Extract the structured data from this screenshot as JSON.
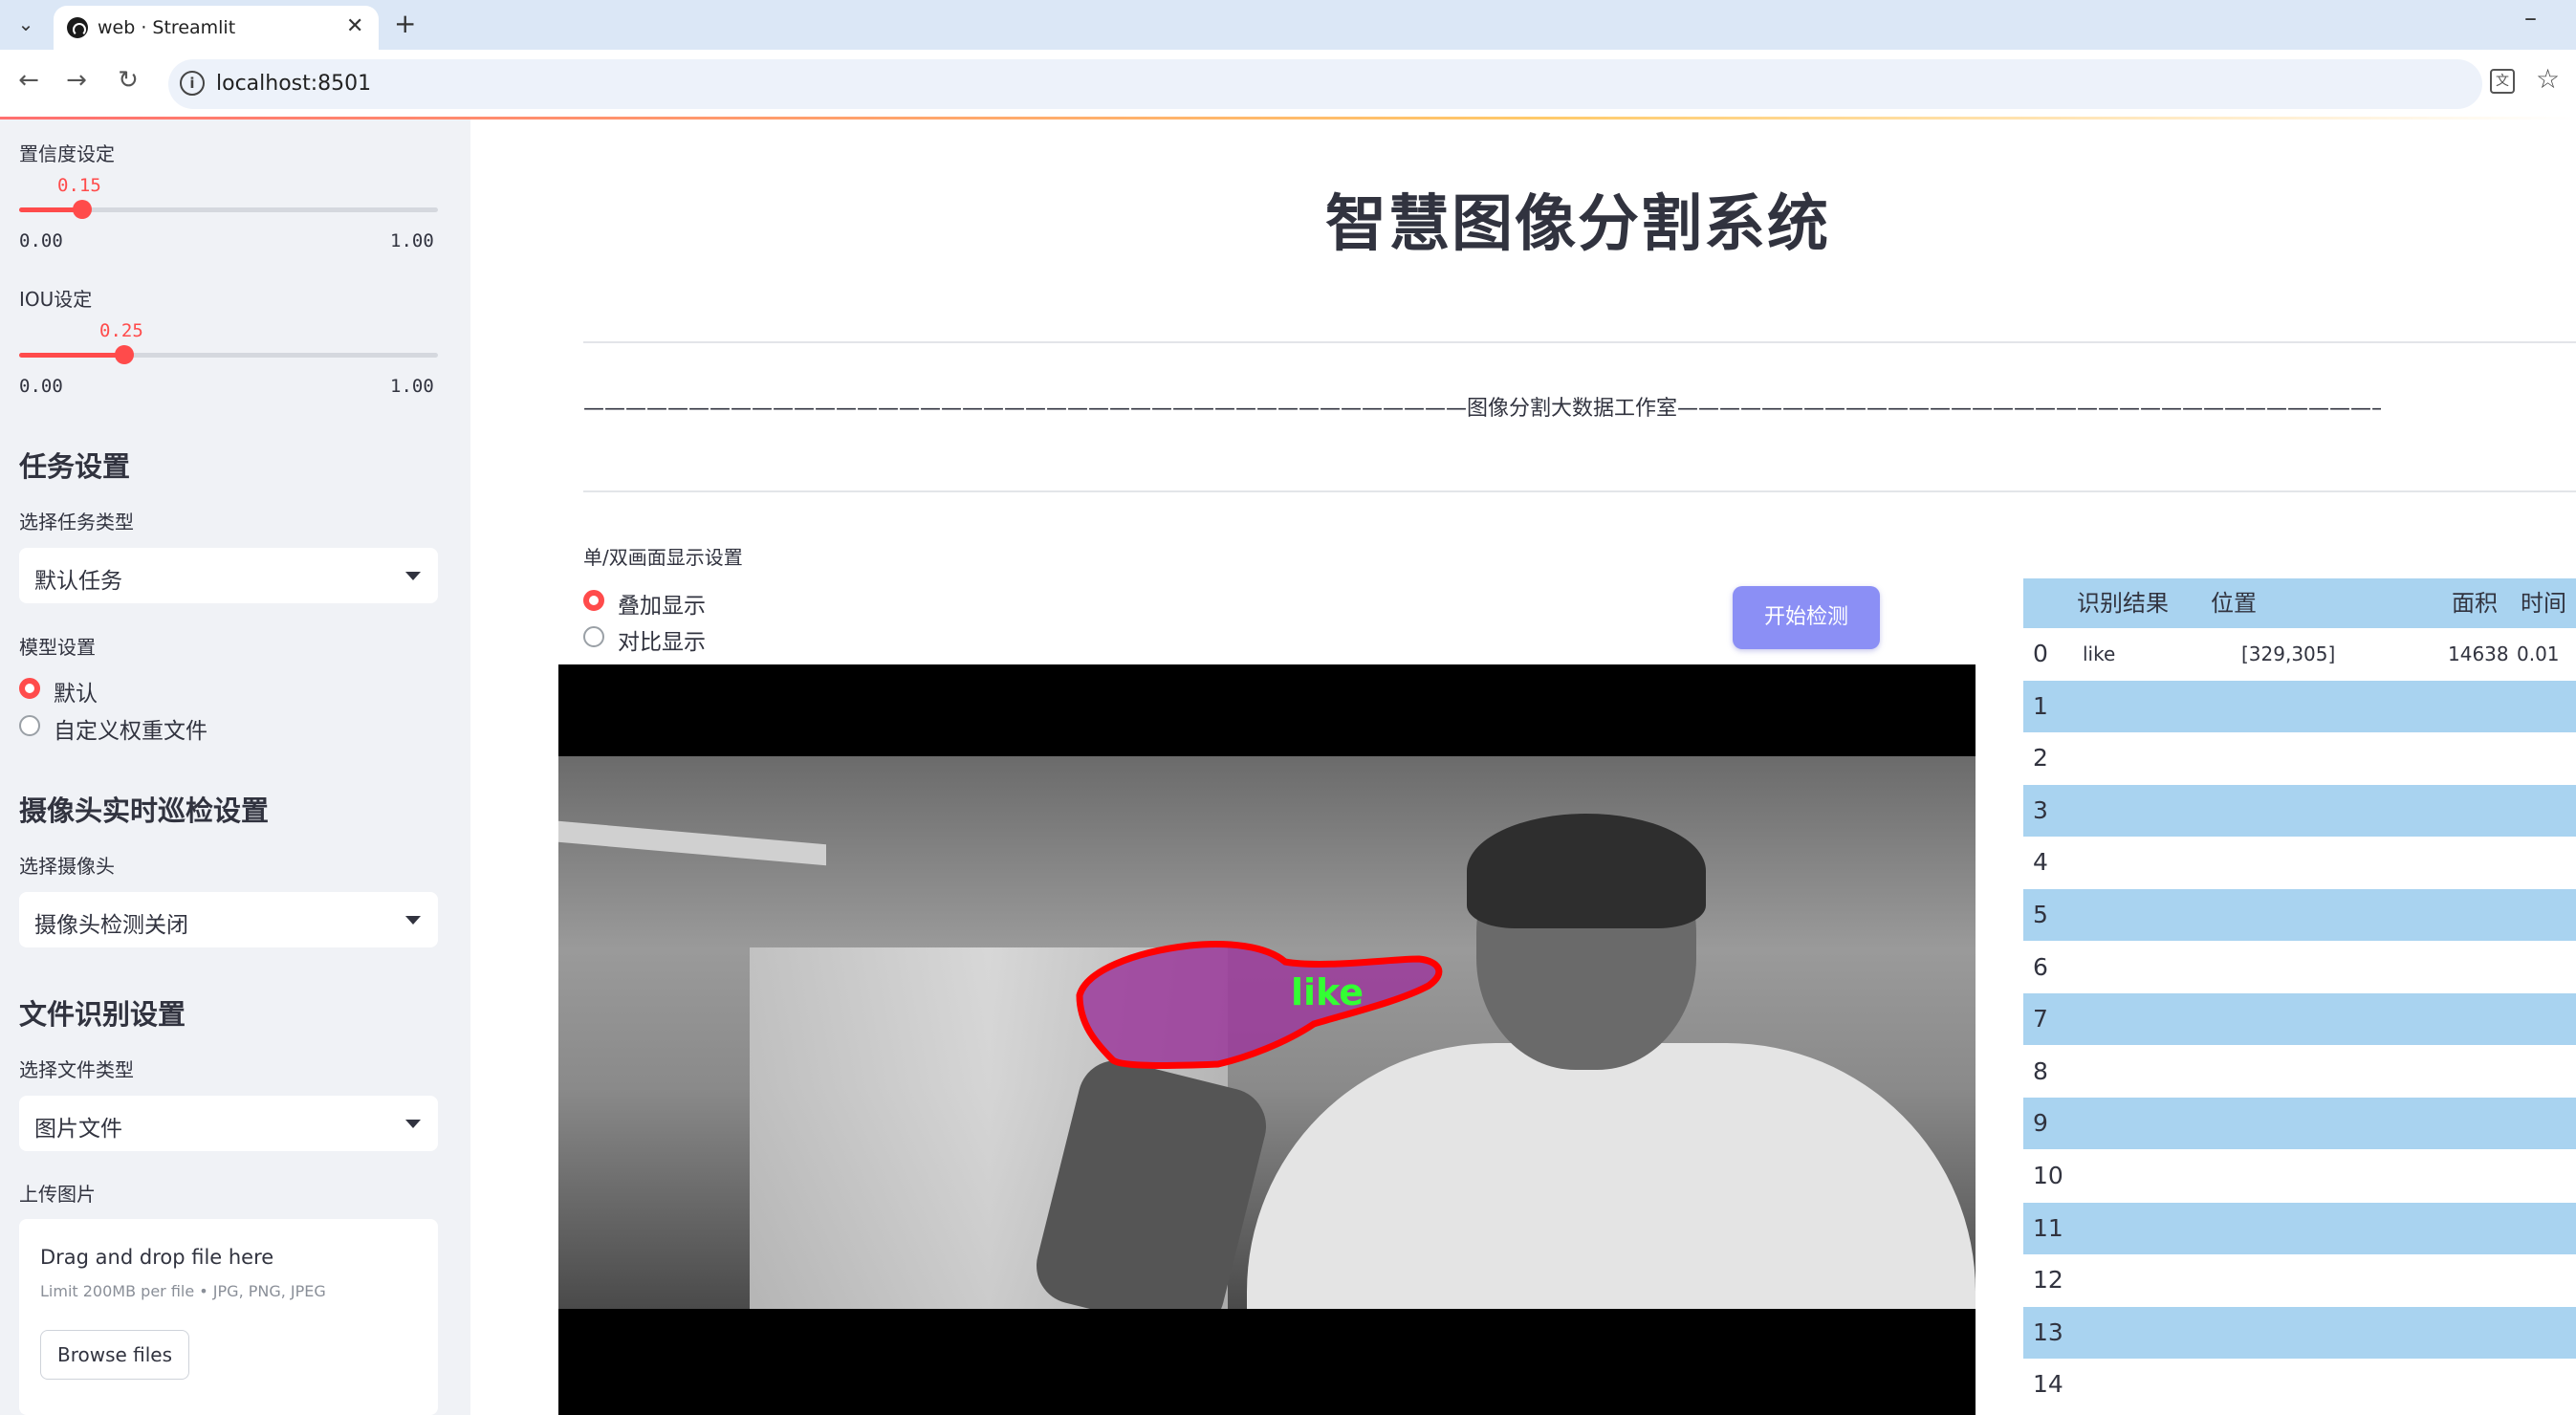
{
  "browser": {
    "tab_title": "web · Streamlit",
    "url": "localhost:8501"
  },
  "sidebar": {
    "confidence": {
      "label": "置信度设定",
      "value": "0.15",
      "value_num": 0.15,
      "min": "0.00",
      "max": "1.00"
    },
    "iou": {
      "label": "IOU设定",
      "value": "0.25",
      "value_num": 0.25,
      "min": "0.00",
      "max": "1.00"
    },
    "task_heading": "任务设置",
    "task_type_label": "选择任务类型",
    "task_type_value": "默认任务",
    "model_label": "模型设置",
    "model_options": [
      "默认",
      "自定义权重文件"
    ],
    "camera_heading": "摄像头实时巡检设置",
    "camera_label": "选择摄像头",
    "camera_value": "摄像头检测关闭",
    "file_heading": "文件识别设置",
    "file_type_label": "选择文件类型",
    "file_type_value": "图片文件",
    "upload_label": "上传图片",
    "uploader": {
      "main": "Drag and drop file here",
      "sub": "Limit 200MB per file • JPG, PNG, JPEG",
      "button": "Browse files"
    }
  },
  "main": {
    "title": "智慧图像分割系统",
    "subtitle_line": "——————————————————————————————————————————图像分割大数据工作室———————————————————————————————————————————",
    "display_label": "单/双画面显示设置",
    "display_options": [
      "叠加显示",
      "对比显示"
    ],
    "start_button": "开始检测",
    "detection_label": "like"
  },
  "results_table": {
    "columns": [
      "识别结果",
      "位置",
      "面积",
      "时间"
    ],
    "rows": [
      {
        "idx": "0",
        "result": "like",
        "position": "[329,305]",
        "area": "14638",
        "time": "0.01"
      },
      {
        "idx": "1"
      },
      {
        "idx": "2"
      },
      {
        "idx": "3"
      },
      {
        "idx": "4"
      },
      {
        "idx": "5"
      },
      {
        "idx": "6"
      },
      {
        "idx": "7"
      },
      {
        "idx": "8"
      },
      {
        "idx": "9"
      },
      {
        "idx": "10"
      },
      {
        "idx": "11"
      },
      {
        "idx": "12"
      },
      {
        "idx": "13"
      },
      {
        "idx": "14"
      }
    ]
  },
  "colors": {
    "accent": "#ff4b4b",
    "button": "#8b8ff5",
    "table_stripe": "#a9d3f0",
    "mask_fill": "#9b3a9b",
    "mask_outline": "#ff0000",
    "label_green": "#33ff33"
  }
}
